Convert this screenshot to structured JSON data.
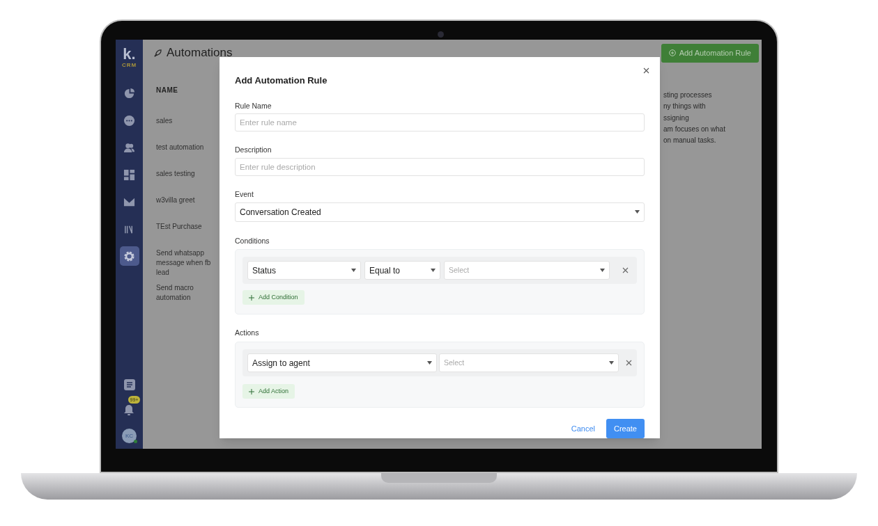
{
  "sidebar": {
    "logo": "k.",
    "logo_sub": "CRM",
    "items": [
      {
        "kind": "chart",
        "selected": false
      },
      {
        "kind": "chat",
        "selected": false
      },
      {
        "kind": "contacts",
        "selected": false
      },
      {
        "kind": "dashboard",
        "selected": false
      },
      {
        "kind": "mail",
        "selected": false
      },
      {
        "kind": "library",
        "selected": false
      },
      {
        "kind": "settings",
        "selected": true
      }
    ],
    "bottom": {
      "notification_count": "99+",
      "avatar_initials": "KC",
      "online": true
    }
  },
  "page": {
    "title": "Automations",
    "add_button": "Add Automation Rule",
    "table": {
      "columns": [
        "NAME"
      ],
      "rows": [
        "sales",
        "test automation",
        "sales testing",
        "w3villa greet",
        "TEst Purchase",
        "Send whatsapp message when fb lead",
        "Send macro automation"
      ]
    },
    "description_lines": [
      "sting processes",
      "ny things with",
      "ssigning",
      "am focuses on what",
      "on manual tasks."
    ]
  },
  "modal": {
    "title": "Add Automation Rule",
    "rule_name": {
      "label": "Rule Name",
      "placeholder": "Enter rule name"
    },
    "description": {
      "label": "Description",
      "placeholder": "Enter rule description"
    },
    "event": {
      "label": "Event",
      "value": "Conversation Created"
    },
    "conditions": {
      "label": "Conditions",
      "rows": [
        {
          "attribute": "Status",
          "operator": "Equal to",
          "value_placeholder": "Select"
        }
      ],
      "add_button": "Add Condition"
    },
    "actions": {
      "label": "Actions",
      "rows": [
        {
          "action": "Assign to agent",
          "value_placeholder": "Select"
        }
      ],
      "add_button": "Add Action"
    },
    "buttons": {
      "cancel": "Cancel",
      "create": "Create"
    }
  }
}
